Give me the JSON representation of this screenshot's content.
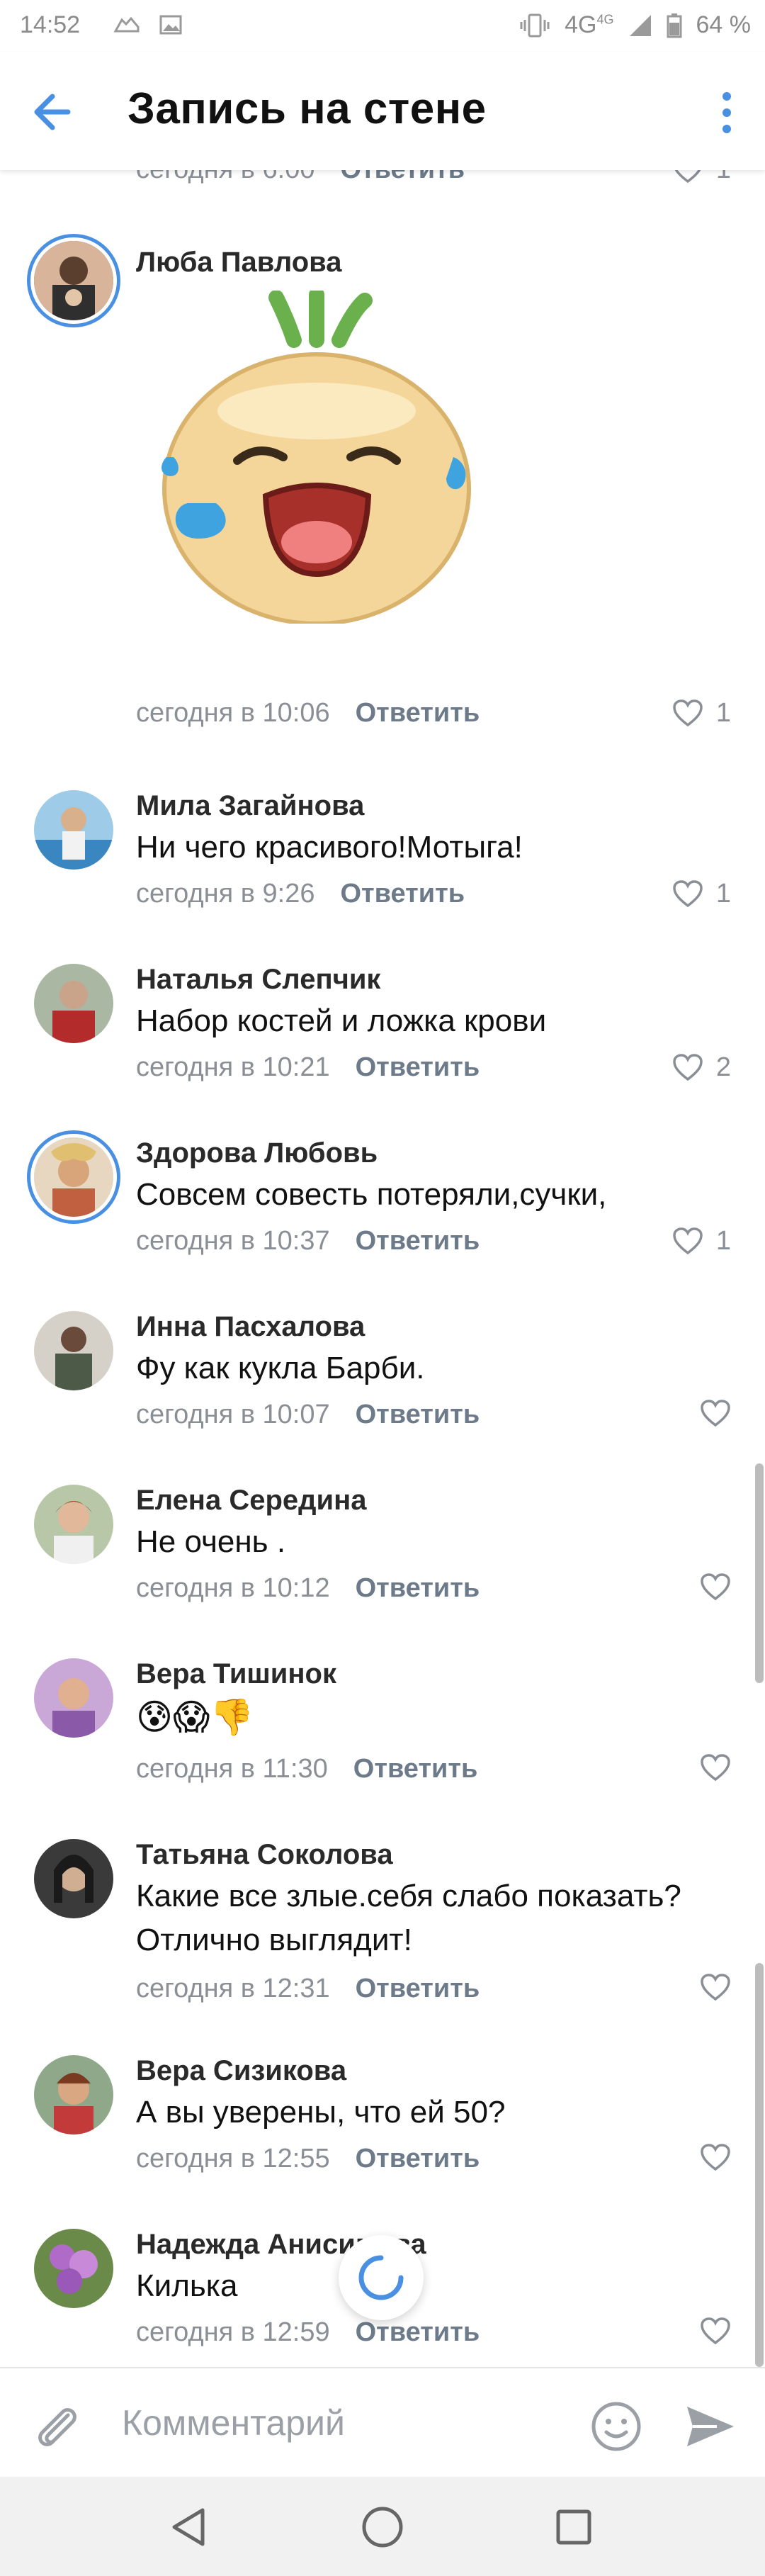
{
  "status_bar": {
    "time": "14:52",
    "network": "4G",
    "network_super": "4G",
    "battery": "64 %"
  },
  "app_bar": {
    "title": "Запись на стене"
  },
  "partial_comment": {
    "time": "сегодня в 6:00",
    "reply": "Ответить",
    "likes": "1"
  },
  "comments": [
    {
      "author": "Люба Павлова",
      "type": "sticker",
      "time": "сегодня в 10:06",
      "reply": "Ответить",
      "likes": "1"
    },
    {
      "author": "Мила Загайнова",
      "text": "Ни чего красивого!Мотыга!",
      "time": "сегодня в 9:26",
      "reply": "Ответить",
      "likes": "1"
    },
    {
      "author": "Наталья Слепчик",
      "text": "Набор костей и ложка крови",
      "time": "сегодня в 10:21",
      "reply": "Ответить",
      "likes": "2"
    },
    {
      "author": "Здорова Любовь",
      "text": "Совсем совесть потеряли,сучки,",
      "time": "сегодня в 10:37",
      "reply": "Ответить",
      "likes": "1"
    },
    {
      "author": "Инна Пасхалова",
      "text": "Фу как кукла Барби.",
      "time": "сегодня в 10:07",
      "reply": "Ответить",
      "likes": ""
    },
    {
      "author": "Елена Середина",
      "text": "Не очень .",
      "time": "сегодня в 10:12",
      "reply": "Ответить",
      "likes": ""
    },
    {
      "author": "Вера Тишинок",
      "text": "😰😱👎",
      "time": "сегодня в 11:30",
      "reply": "Ответить",
      "likes": ""
    },
    {
      "author": "Татьяна Соколова",
      "text": "Какие все злые.себя слабо показать?",
      "text2": "Отлично выглядит!",
      "time": "сегодня в 12:31",
      "reply": "Ответить",
      "likes": ""
    },
    {
      "author": "Вера Сизикова",
      "text": "А вы уверены, что ей 50?",
      "time": "сегодня в 12:55",
      "reply": "Ответить",
      "likes": ""
    },
    {
      "author": "Надежда Анисимова",
      "text": "Килька",
      "time": "сегодня в 12:59",
      "reply": "Ответить",
      "likes": ""
    }
  ],
  "composer": {
    "placeholder": "Комментарий"
  },
  "colors": {
    "accent": "#4a90e2",
    "meta": "#8a8f96",
    "reply": "#6c7a89"
  },
  "icons": {
    "back": "arrow-left-icon",
    "more": "more-vertical-icon",
    "like": "heart-outline-icon",
    "attach": "paperclip-icon",
    "emoji": "smile-icon",
    "send": "send-icon",
    "nav": [
      "back-triangle-icon",
      "home-circle-icon",
      "recents-square-icon"
    ]
  }
}
